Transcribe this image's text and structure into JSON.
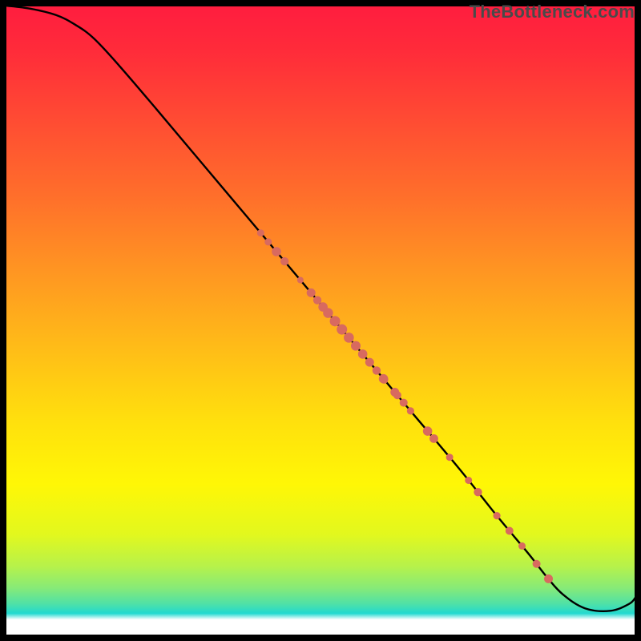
{
  "watermark": "TheBottleneck.com",
  "colors": {
    "dot": "#d86a5f",
    "line": "#000000",
    "border": "#000000",
    "white_strip": "#ffffff"
  },
  "chart_data": {
    "type": "line",
    "title": "",
    "xlabel": "",
    "ylabel": "",
    "xlim": [
      0,
      100
    ],
    "ylim": [
      0,
      100
    ],
    "grid": false,
    "legend": null,
    "gradient_background": true,
    "gradient_stops": [
      {
        "pos": 0.0,
        "color": "#ff1d3f"
      },
      {
        "pos": 0.07,
        "color": "#ff2b3a"
      },
      {
        "pos": 0.18,
        "color": "#ff4b33"
      },
      {
        "pos": 0.3,
        "color": "#ff6e2b"
      },
      {
        "pos": 0.42,
        "color": "#ff9522"
      },
      {
        "pos": 0.54,
        "color": "#ffbb18"
      },
      {
        "pos": 0.66,
        "color": "#ffe00d"
      },
      {
        "pos": 0.76,
        "color": "#fff706"
      },
      {
        "pos": 0.84,
        "color": "#e2f81e"
      },
      {
        "pos": 0.89,
        "color": "#b7f24a"
      },
      {
        "pos": 0.925,
        "color": "#86ea78"
      },
      {
        "pos": 0.95,
        "color": "#4fe1a7"
      },
      {
        "pos": 0.965,
        "color": "#22d9cf"
      },
      {
        "pos": 0.975,
        "color": "#ffffff"
      },
      {
        "pos": 1.0,
        "color": "#ffffff"
      }
    ],
    "series": [
      {
        "name": "curve",
        "x": [
          0,
          4,
          8,
          11,
          14,
          18,
          24,
          32,
          40,
          48,
          56,
          64,
          72,
          78,
          83,
          86,
          88.5,
          92,
          96,
          99,
          100
        ],
        "y": [
          100,
          99.5,
          98.5,
          97,
          94.8,
          90.5,
          83.5,
          74,
          64.5,
          55,
          45.5,
          36,
          26.5,
          19,
          13,
          9.2,
          6.5,
          4.3,
          3.9,
          5,
          6
        ]
      }
    ],
    "dots": {
      "name": "points-on-curve",
      "x_positions": [
        40.5,
        41.7,
        43.0,
        44.3,
        46.8,
        48.5,
        49.5,
        50.4,
        51.2,
        52.3,
        53.4,
        54.5,
        55.6,
        56.7,
        57.8,
        58.9,
        60.0,
        60.1,
        61.8,
        62.2,
        63.2,
        64.3,
        67.0,
        68.0,
        70.5,
        73.5,
        75.0,
        78.0,
        80.0,
        82.0,
        84.3,
        86.2
      ],
      "sizes": [
        4.5,
        4.5,
        5.8,
        5.2,
        4.0,
        5.5,
        5.2,
        5.8,
        6.2,
        6.5,
        6.5,
        6.3,
        6.0,
        5.8,
        5.5,
        5.2,
        5.8,
        5.2,
        5.5,
        5.0,
        5.0,
        4.6,
        5.8,
        5.4,
        4.5,
        4.5,
        5.2,
        4.6,
        5.0,
        4.5,
        5.0,
        5.5
      ]
    }
  }
}
